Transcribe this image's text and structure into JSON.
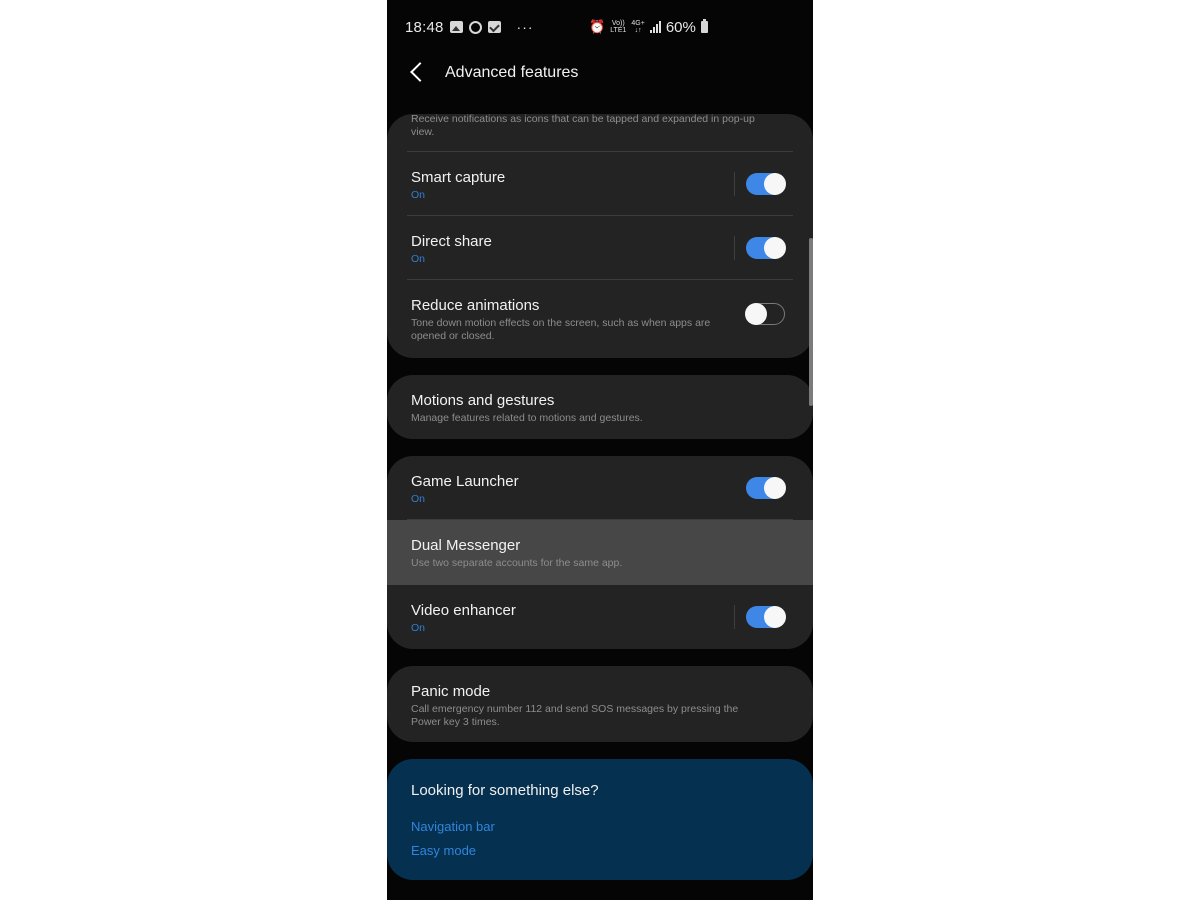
{
  "status_bar": {
    "time": "18:48",
    "left_icons": [
      "gallery-icon",
      "whatsapp-icon",
      "email-icon",
      "more-notifications-icon"
    ],
    "more_dots": "···",
    "volte_top": "Vo))",
    "volte_bottom": "LTE1",
    "net_top": "4G+",
    "net_bottom": "↓↑",
    "battery_percent": "60%"
  },
  "header": {
    "title": "Advanced features"
  },
  "sections": {
    "first": {
      "partial_desc": "Receive notifications as icons that can be tapped and expanded in pop-up view.",
      "items": [
        {
          "label": "Smart capture",
          "status": "On",
          "toggle": true
        },
        {
          "label": "Direct share",
          "status": "On",
          "toggle": true
        },
        {
          "label": "Reduce animations",
          "desc": "Tone down motion effects on the screen, such as when apps are opened or closed.",
          "toggle": false
        }
      ]
    },
    "motions": {
      "label": "Motions and gestures",
      "desc": "Manage features related to motions and gestures."
    },
    "third": {
      "items": [
        {
          "label": "Game Launcher",
          "status": "On",
          "toggle": true
        },
        {
          "label": "Dual Messenger",
          "desc": "Use two separate accounts for the same app."
        },
        {
          "label": "Video enhancer",
          "status": "On",
          "toggle": true
        }
      ]
    },
    "panic": {
      "label": "Panic mode",
      "desc": "Call emergency number 112 and send SOS messages by pressing the Power key 3 times."
    }
  },
  "suggestions": {
    "title": "Looking for something else?",
    "links": [
      "Navigation bar",
      "Easy mode"
    ]
  },
  "colors": {
    "accent": "#3e87e6",
    "status_on": "#2f7fd4",
    "card_bg": "#232323",
    "suggest_bg": "#06304f",
    "link": "#2f86dc"
  }
}
